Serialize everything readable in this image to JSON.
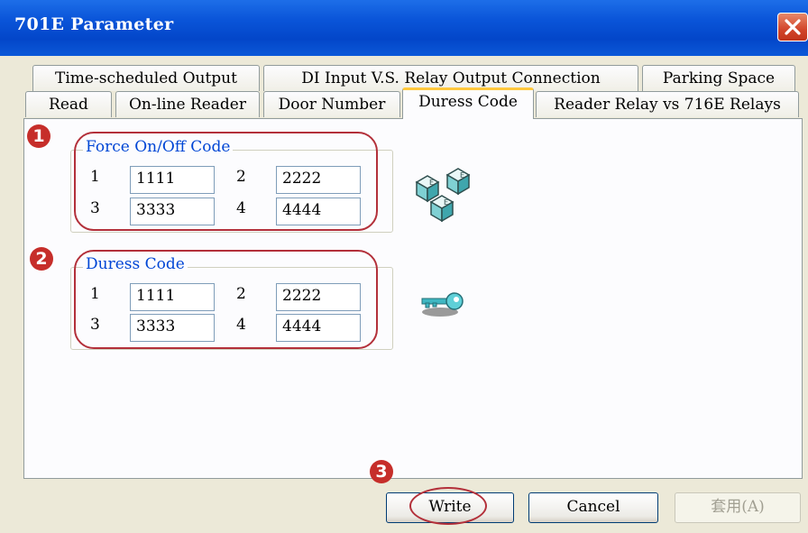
{
  "window": {
    "title": "701E Parameter"
  },
  "tabs_row1": [
    "Time-scheduled Output",
    "DI Input  V.S. Relay Output Connection",
    "Parking Space"
  ],
  "tabs_row2": [
    "Read",
    "On-line Reader",
    "Door Number",
    "Duress Code",
    "Reader Relay vs 716E Relays"
  ],
  "active_tab": "Duress Code",
  "force_group": {
    "legend": "Force On/Off Code",
    "labels": [
      "1",
      "2",
      "3",
      "4"
    ],
    "values": [
      "1111",
      "2222",
      "3333",
      "4444"
    ]
  },
  "duress_group": {
    "legend": "Duress Code",
    "labels": [
      "1",
      "2",
      "3",
      "4"
    ],
    "values": [
      "1111",
      "2222",
      "3333",
      "4444"
    ]
  },
  "badges": [
    "1",
    "2",
    "3"
  ],
  "buttons": {
    "write": "Write",
    "cancel": "Cancel",
    "apply": "套用(A)"
  },
  "colors": {
    "titlebar": "#0a55d9",
    "legend": "#0046d5",
    "annotation": "#c62e2a",
    "tab_highlight": "#ffc83c"
  }
}
